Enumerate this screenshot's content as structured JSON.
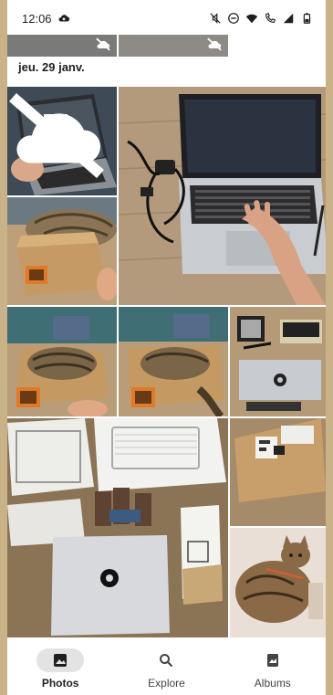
{
  "status_bar": {
    "time": "12:06",
    "icons": [
      "cloud-sync-icon",
      "mute-icon",
      "dnd-icon",
      "wifi-icon",
      "call-icon",
      "signal-icon",
      "battery-icon"
    ]
  },
  "section": {
    "date_heading": "jeu. 29 janv."
  },
  "photos": [
    {
      "name": "photo-laptop-qr",
      "icon": "cloud-off-icon"
    },
    {
      "name": "photo-laptop-desk",
      "icon": ""
    },
    {
      "name": "photo-cat-box-1",
      "icon": ""
    },
    {
      "name": "photo-cat-box-2",
      "icon": ""
    },
    {
      "name": "photo-cat-box-3",
      "icon": ""
    },
    {
      "name": "photo-parts-top",
      "icon": ""
    },
    {
      "name": "photo-unboxing",
      "icon": ""
    },
    {
      "name": "photo-shipping-box",
      "icon": ""
    },
    {
      "name": "photo-cat-bed",
      "icon": ""
    }
  ],
  "nav": {
    "photos_label": "Photos",
    "explore_label": "Explore",
    "albums_label": "Albums"
  },
  "colors": {
    "accent": "#1f1f1f",
    "nav_active_bg": "#e3e3e3"
  }
}
